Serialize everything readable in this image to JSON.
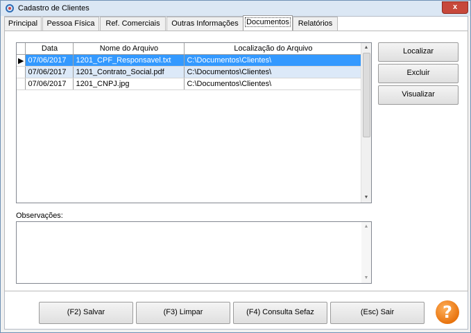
{
  "window": {
    "title": "Cadastro de Clientes",
    "close_glyph": "x"
  },
  "tabs": [
    {
      "label": "Principal"
    },
    {
      "label": "Pessoa Física"
    },
    {
      "label": "Ref. Comerciais"
    },
    {
      "label": "Outras Informações"
    },
    {
      "label": "Documentos",
      "active": true
    },
    {
      "label": "Relatórios"
    }
  ],
  "documents": {
    "columns": [
      "Data",
      "Nome do Arquivo",
      "Localização do Arquivo"
    ],
    "rows": [
      {
        "data": "07/06/2017",
        "nome": "1201_CPF_Responsavel.txt",
        "local": "C:\\Documentos\\Clientes\\"
      },
      {
        "data": "07/06/2017",
        "nome": "1201_Contrato_Social.pdf",
        "local": "C:\\Documentos\\Clientes\\"
      },
      {
        "data": "07/06/2017",
        "nome": "1201_CNPJ.jpg",
        "local": "C:\\Documentos\\Clientes\\"
      }
    ],
    "selected_row": 0
  },
  "side_buttons": {
    "localizar": "Localizar",
    "excluir": "Excluir",
    "visualizar": "Visualizar"
  },
  "observacoes": {
    "label": "Observações:",
    "value": ""
  },
  "bottom_buttons": {
    "salvar": "(F2) Salvar",
    "limpar": "(F3) Limpar",
    "consulta": "(F4) Consulta Sefaz",
    "sair": "(Esc) Sair"
  },
  "help": {
    "glyph": "?"
  },
  "colors": {
    "selection": "#3399ff",
    "alt_row": "#dce9f8",
    "help": "#e8740f",
    "close": "#c7483b"
  }
}
